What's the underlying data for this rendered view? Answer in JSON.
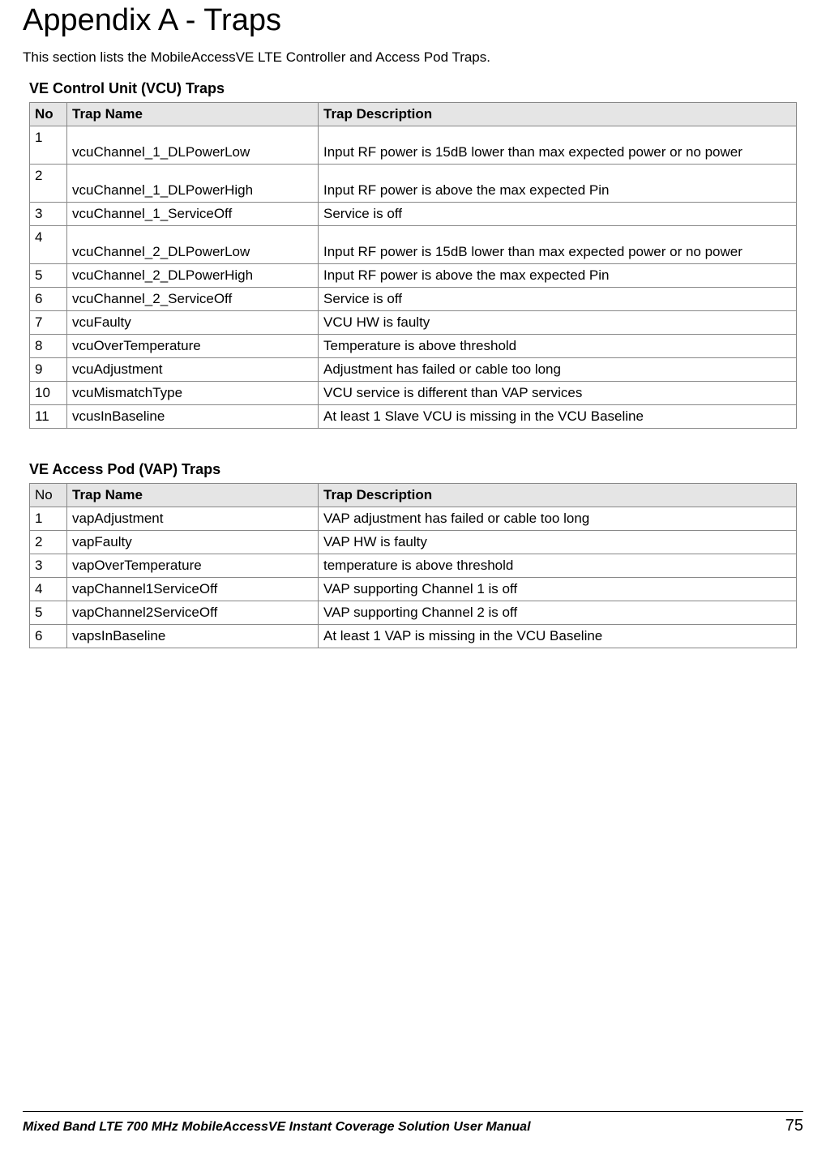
{
  "title": "Appendix A - Traps",
  "intro": "This section lists the MobileAccessVE LTE Controller and Access Pod Traps.",
  "vcu": {
    "title": "VE Control Unit (VCU) Traps",
    "headers": {
      "no": "No",
      "name": "Trap Name",
      "desc": "Trap Description"
    },
    "rows": [
      {
        "no": "1",
        "name": "vcuChannel_1_DLPowerLow",
        "desc": "Input RF power is 15dB lower than max expected power or no power",
        "pad": true
      },
      {
        "no": "2",
        "name": "vcuChannel_1_DLPowerHigh",
        "desc": "Input RF power is above the max expected Pin",
        "pad": true
      },
      {
        "no": "3",
        "name": "vcuChannel_1_ServiceOff",
        "desc": "Service is off"
      },
      {
        "no": "4",
        "name": "vcuChannel_2_DLPowerLow",
        "desc": "Input RF power is 15dB lower than max expected power or no power",
        "pad": true
      },
      {
        "no": "5",
        "name": "vcuChannel_2_DLPowerHigh",
        "desc": "Input RF power is above the max expected Pin"
      },
      {
        "no": "6",
        "name": "vcuChannel_2_ServiceOff",
        "desc": "Service is off"
      },
      {
        "no": "7",
        "name": "vcuFaulty",
        "desc": "VCU HW is faulty"
      },
      {
        "no": "8",
        "name": "vcuOverTemperature",
        "desc": "Temperature is above threshold"
      },
      {
        "no": "9",
        "name": "vcuAdjustment",
        "desc": "Adjustment has failed or cable too long"
      },
      {
        "no": "10",
        "name": "vcuMismatchType",
        "desc": "VCU service  is different than VAP services"
      },
      {
        "no": "11",
        "name": "vcusInBaseline",
        "desc": "At least 1 Slave VCU is missing in the VCU Baseline"
      }
    ]
  },
  "vap": {
    "title": "VE Access Pod (VAP) Traps",
    "headers": {
      "no": "No",
      "name": "Trap Name",
      "desc": "Trap Description"
    },
    "rows": [
      {
        "no": "1",
        "name": "vapAdjustment",
        "desc": "VAP adjustment has failed or cable too long"
      },
      {
        "no": "2",
        "name": "vapFaulty",
        "desc": "VAP HW is faulty"
      },
      {
        "no": "3",
        "name": "vapOverTemperature",
        "desc": "temperature is above threshold"
      },
      {
        "no": "4",
        "name": "vapChannel1ServiceOff",
        "desc": "VAP supporting Channel 1 is off"
      },
      {
        "no": "5",
        "name": "vapChannel2ServiceOff",
        "desc": "VAP supporting Channel 2  is off"
      },
      {
        "no": "6",
        "name": "vapsInBaseline",
        "desc": "At least 1 VAP is missing in the VCU Baseline"
      }
    ]
  },
  "footer": {
    "left": "Mixed Band LTE 700 MHz MobileAccessVE Instant Coverage Solution User Manual",
    "right": "75"
  }
}
